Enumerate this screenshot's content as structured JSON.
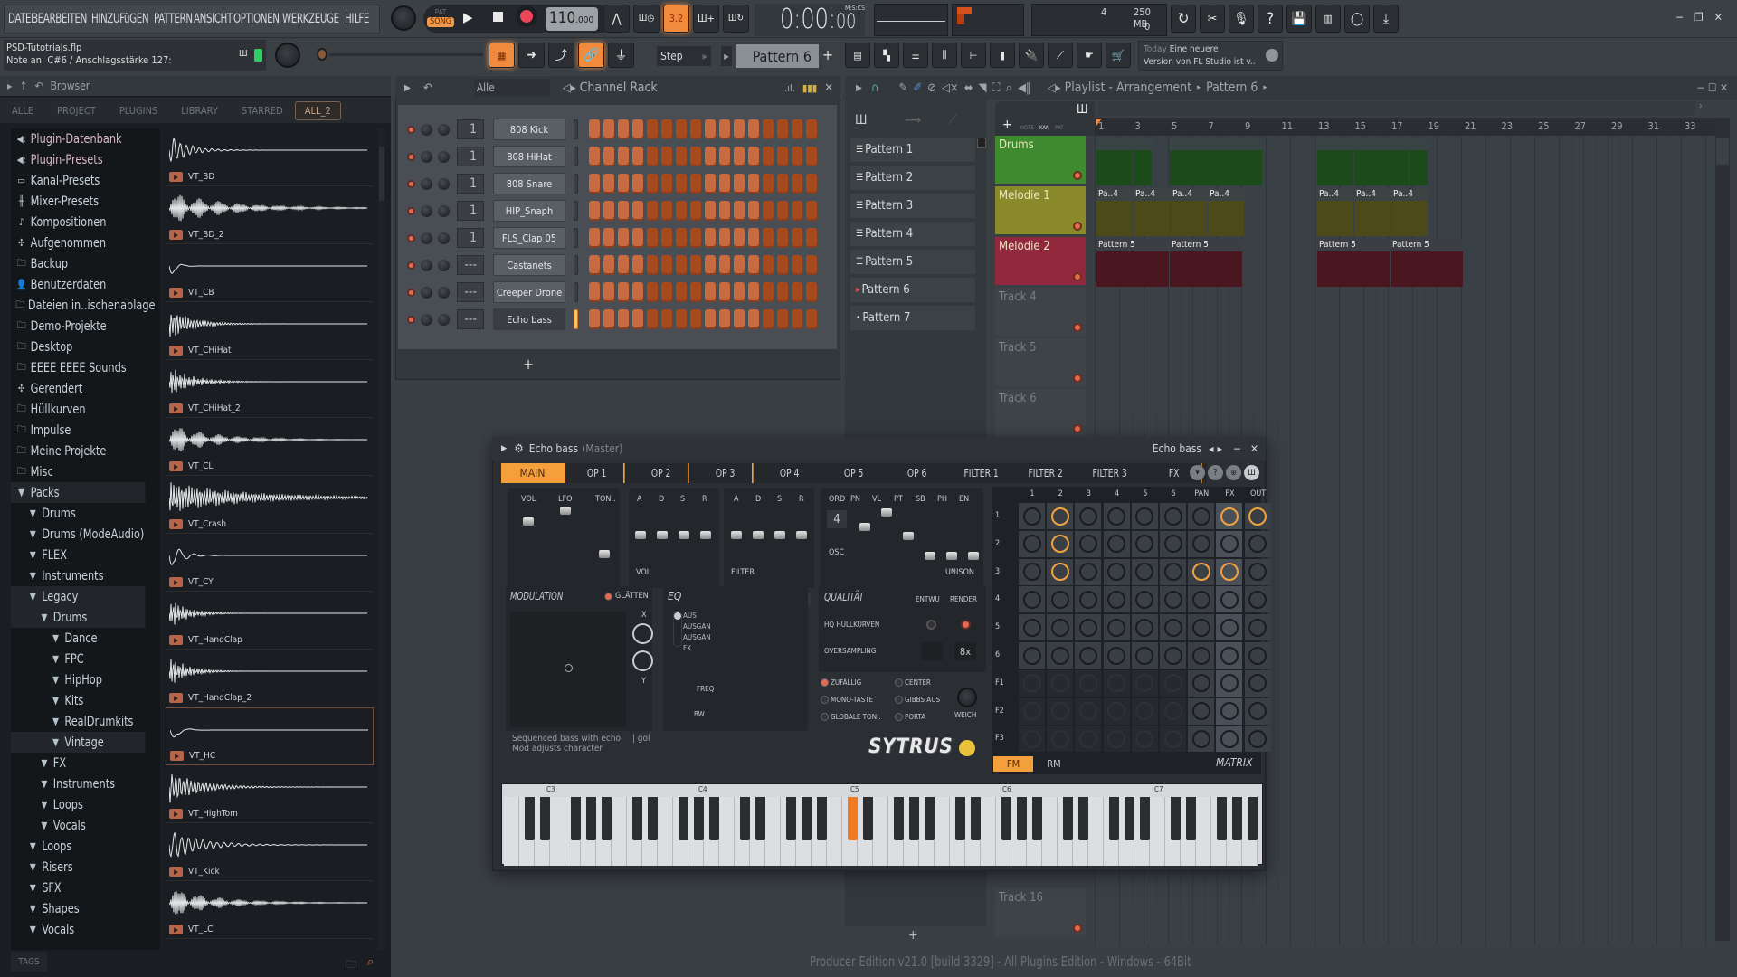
{
  "menu": [
    "DATEI",
    "BEARBEITEN",
    "HINZUFüGEN",
    "PATTERN",
    "ANSICHT",
    "OPTIONEN",
    "WERKZEUGE",
    "HILFE"
  ],
  "transport": {
    "pat_label": "PAT",
    "song_label": "SONG",
    "tempo": "110",
    "tempo_decimals": ".000",
    "time": "0:00:",
    "time_cs": "00",
    "time_unit": "M:S:CS",
    "snap_display": "3.2"
  },
  "cpu": {
    "polyphony": "4",
    "memory": "250 MB",
    "voices": "0"
  },
  "file": {
    "name": "PSD-Tutotrials.flp",
    "note_info": "Note an: C#6 / Anschlagsstärke 127:"
  },
  "toolbar2": {
    "snap_mode": "Step",
    "pattern": "Pattern 6",
    "add": "+"
  },
  "news": {
    "when": "Today",
    "line1": "Eine neuere",
    "line2": "Version von FL Studio ist v.."
  },
  "browser": {
    "title": "Browser",
    "tabs": [
      "ALLE",
      "PROJECT",
      "PLUGINS",
      "LIBRARY",
      "STARRED",
      "ALL_2"
    ],
    "active_tab": "ALL_2",
    "tree": [
      {
        "label": "Plugin-Datenbank",
        "icon": "plug",
        "indent": 0
      },
      {
        "label": "Plugin-Presets",
        "icon": "plug",
        "indent": 0
      },
      {
        "label": "Kanal-Presets",
        "icon": "channel",
        "indent": 0
      },
      {
        "label": "Mixer-Presets",
        "icon": "mixer",
        "indent": 0
      },
      {
        "label": "Kompositionen",
        "icon": "note",
        "indent": 0
      },
      {
        "label": "Aufgenommen",
        "icon": "wave",
        "indent": 0
      },
      {
        "label": "Backup",
        "icon": "folder",
        "indent": 0
      },
      {
        "label": "Benutzerdaten",
        "icon": "user",
        "indent": 0
      },
      {
        "label": "Dateien in..ischenablage",
        "icon": "folder",
        "indent": 0
      },
      {
        "label": "Demo-Projekte",
        "icon": "folder",
        "indent": 0
      },
      {
        "label": "Desktop",
        "icon": "folder",
        "indent": 0
      },
      {
        "label": "EEEE EEEE Sounds",
        "icon": "folder",
        "indent": 0
      },
      {
        "label": "Gerendert",
        "icon": "render",
        "indent": 0
      },
      {
        "label": "Hüllkurven",
        "icon": "folder",
        "indent": 0
      },
      {
        "label": "Impulse",
        "icon": "folder",
        "indent": 0
      },
      {
        "label": "Meine Projekte",
        "icon": "folder",
        "indent": 0
      },
      {
        "label": "Misc",
        "icon": "folder",
        "indent": 0
      },
      {
        "label": "Packs",
        "icon": "pack",
        "indent": 0
      },
      {
        "label": "Drums",
        "icon": "pack",
        "indent": 1
      },
      {
        "label": "Drums (ModeAudio)",
        "icon": "pack",
        "indent": 1
      },
      {
        "label": "FLEX",
        "icon": "pack",
        "indent": 1
      },
      {
        "label": "Instruments",
        "icon": "pack",
        "indent": 1
      },
      {
        "label": "Legacy",
        "icon": "pack",
        "indent": 1
      },
      {
        "label": "Drums",
        "icon": "pack",
        "indent": 2
      },
      {
        "label": "Dance",
        "icon": "pack",
        "indent": 3
      },
      {
        "label": "FPC",
        "icon": "pack",
        "indent": 3
      },
      {
        "label": "HipHop",
        "icon": "pack",
        "indent": 3
      },
      {
        "label": "Kits",
        "icon": "pack",
        "indent": 3
      },
      {
        "label": "RealDrumkits",
        "icon": "pack",
        "indent": 3
      },
      {
        "label": "Vintage",
        "icon": "pack",
        "indent": 3
      },
      {
        "label": "FX",
        "icon": "pack",
        "indent": 2
      },
      {
        "label": "Instruments",
        "icon": "pack",
        "indent": 2
      },
      {
        "label": "Loops",
        "icon": "pack",
        "indent": 2
      },
      {
        "label": "Vocals",
        "icon": "pack",
        "indent": 2
      },
      {
        "label": "Loops",
        "icon": "pack",
        "indent": 1
      },
      {
        "label": "Risers",
        "icon": "pack",
        "indent": 1
      },
      {
        "label": "SFX",
        "icon": "pack",
        "indent": 1
      },
      {
        "label": "Shapes",
        "icon": "pack",
        "indent": 1
      },
      {
        "label": "Vocals",
        "icon": "pack",
        "indent": 1
      }
    ],
    "samples": [
      "VT_BD",
      "VT_BD_2",
      "VT_CB",
      "VT_CHiHat",
      "VT_CHiHat_2",
      "VT_CL",
      "VT_Crash",
      "VT_CY",
      "VT_HandClap",
      "VT_HandClap_2",
      "VT_HC",
      "VT_HighTom",
      "VT_Kick",
      "VT_LC"
    ],
    "selected_sample": "VT_HC",
    "tags_label": "TAGS"
  },
  "channel_rack": {
    "title": "Channel Rack",
    "filter": "Alle",
    "channels": [
      {
        "name": "808 Kick",
        "route": "1"
      },
      {
        "name": "808 HiHat",
        "route": "1"
      },
      {
        "name": "808 Snare",
        "route": "1"
      },
      {
        "name": "HIP_Snaph",
        "route": "1"
      },
      {
        "name": "FLS_Clap 05",
        "route": "1"
      },
      {
        "name": "Castanets",
        "route": "---"
      },
      {
        "name": "Creeper Drone",
        "route": "---"
      },
      {
        "name": "Echo bass",
        "route": "---"
      }
    ],
    "selected_channel": "Echo bass",
    "add_label": "+"
  },
  "patterns": [
    "Pattern 1",
    "Pattern 2",
    "Pattern 3",
    "Pattern 4",
    "Pattern 5",
    "Pattern 6",
    "Pattern 7"
  ],
  "current_pattern": "Pattern 6",
  "playlist": {
    "title": "Playlist - Arrangement",
    "crumb": "Pattern 6",
    "tabs": [
      "NOTE",
      "KAN",
      "PAT"
    ],
    "ruler": [
      "1",
      "3",
      "5",
      "7",
      "9",
      "11",
      "13",
      "15",
      "17",
      "19",
      "21",
      "23",
      "25",
      "27",
      "29",
      "31",
      "33"
    ],
    "tracks": [
      {
        "name": "Drums",
        "color": "#3f8a2f"
      },
      {
        "name": "Melodie 1",
        "color": "#8a8a2a"
      },
      {
        "name": "Melodie 2",
        "color": "#92283d"
      },
      {
        "name": "Track 4",
        "color": ""
      },
      {
        "name": "Track 5",
        "color": ""
      },
      {
        "name": "Track 6",
        "color": ""
      },
      {
        "name": "Track 16",
        "color": ""
      }
    ],
    "clip_labels": {
      "melodie1": "Pa..4",
      "melodie2": "Pattern 5"
    }
  },
  "sytrus": {
    "title": "Echo bass",
    "subtitle": "(Master)",
    "nav_name": "Echo bass",
    "tabs": [
      "MAIN",
      "OP 1",
      "OP 2",
      "OP 3",
      "OP 4",
      "OP 5",
      "OP 6",
      "FILTER 1",
      "FILTER 2",
      "FILTER 3",
      "FX"
    ],
    "active_tab": "MAIN",
    "main_labels": [
      "VOL",
      "LFO",
      "TON.."
    ],
    "adsr": [
      "A",
      "D",
      "S",
      "R"
    ],
    "osc_labels": [
      "ORD",
      "PN",
      "VL",
      "PT",
      "SB",
      "PH",
      "EN"
    ],
    "ord_value": "4",
    "osc_label": "OSC",
    "vol_env": "VOL",
    "filter_env": "FILTER",
    "unison": "UNISON",
    "modulation": "MODULATION",
    "glatten": "GLÄTTEN",
    "x": "X",
    "y": "Y",
    "eq": "EQ",
    "eq_modes": [
      "AUS",
      "AUSGAN",
      "AUSGAN",
      "FX"
    ],
    "freq": "FREQ",
    "bw": "BW",
    "quality": "QUALITÄT",
    "entwu": "ENTWU",
    "render": "RENDER",
    "hq": "HQ HULLKURVEN",
    "oversampling": "OVERSAMPLING",
    "oversampling_value": "8x",
    "options": [
      "ZUFÄLLIG",
      "CENTER",
      "MONO-TASTE",
      "GIBBS AUS",
      "GLOBALE TON..",
      "PORTA"
    ],
    "weich": "WEICH",
    "description1": "Sequenced bass with echo",
    "description2": "Mod adjusts character",
    "author": "| gol",
    "logo": "SYTRUS",
    "matrix_cols": [
      "1",
      "2",
      "3",
      "4",
      "5",
      "6",
      "PAN",
      "FX",
      "OUT"
    ],
    "matrix_rows": [
      "1",
      "2",
      "3",
      "4",
      "5",
      "6",
      "F1",
      "F2",
      "F3"
    ],
    "matrix_modes": [
      "FM",
      "RM"
    ],
    "matrix_label": "MATRIX",
    "keyboard_labels": [
      "C3",
      "C4",
      "C5",
      "C6",
      "C7"
    ],
    "pressed_key": "C#6"
  },
  "status": "Producer Edition v21.0 [build 3329] - All Plugins Edition - Windows - 64Bit"
}
